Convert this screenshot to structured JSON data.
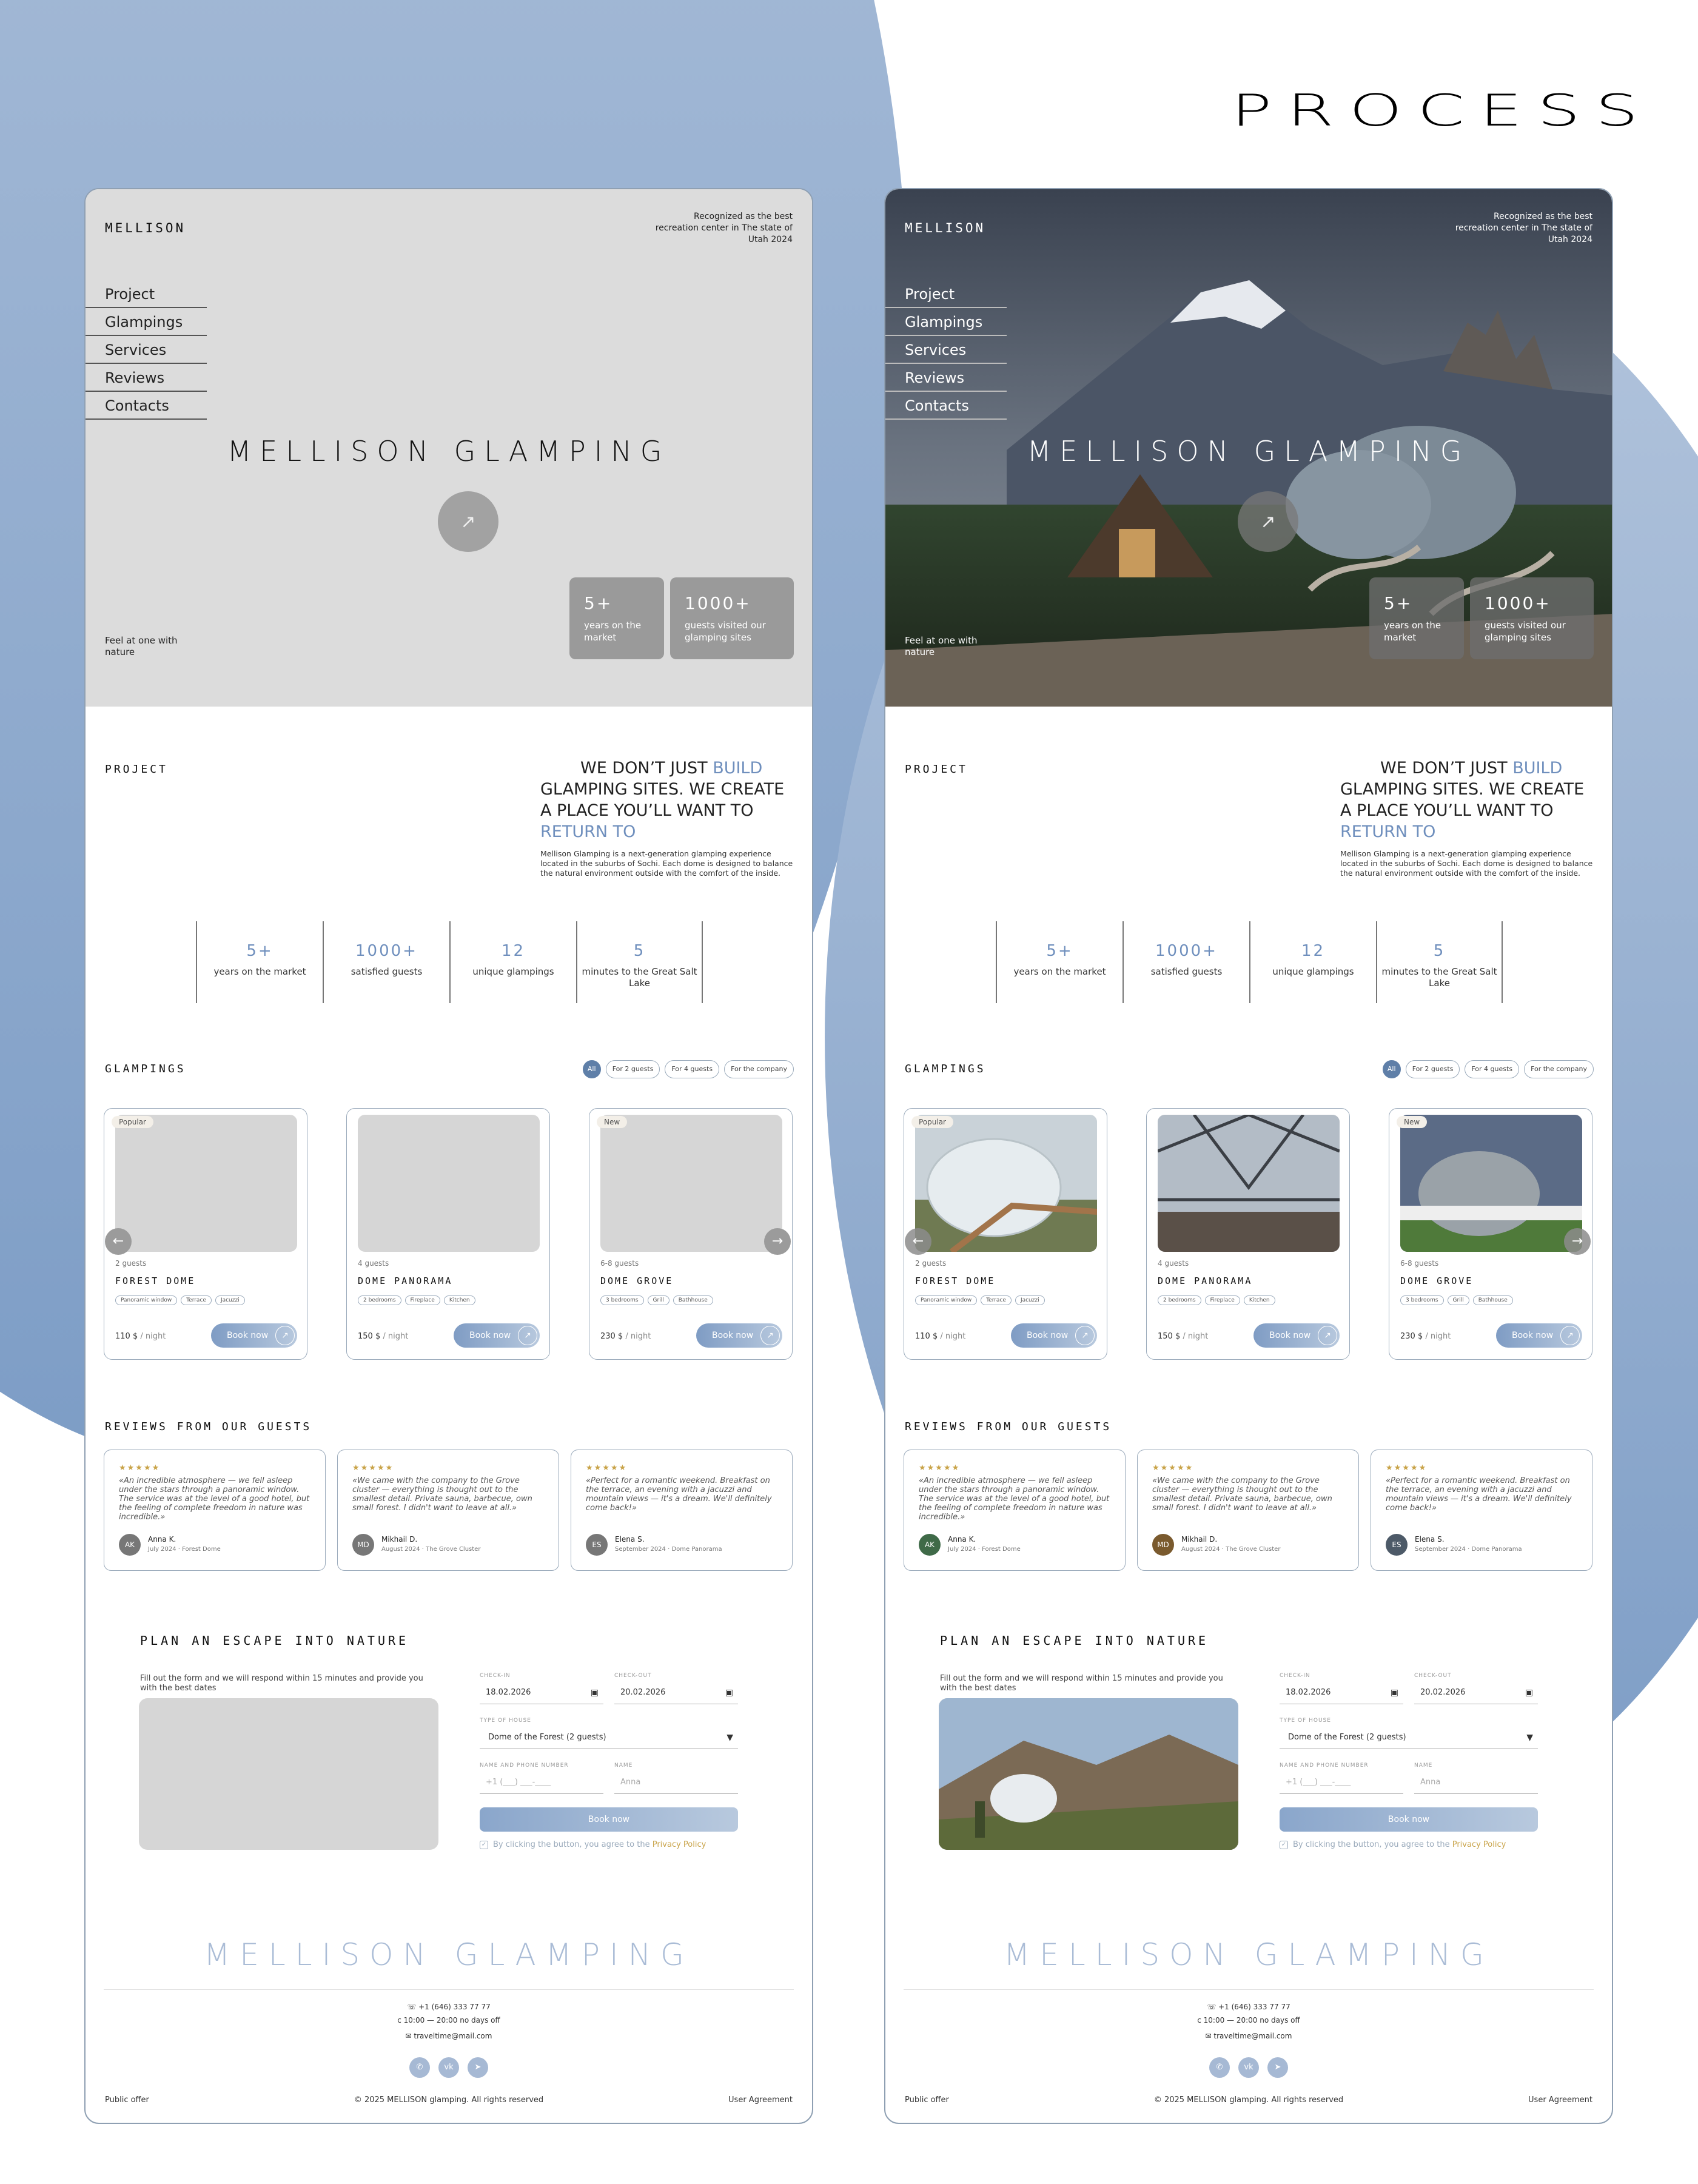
{
  "page": {
    "title": "PROCESS",
    "colors": {
      "accent": "#6f8fbd",
      "blob": "#8fa8cb",
      "gold": "#c9a44a"
    }
  },
  "site": {
    "logo": "MELLISON",
    "recognition": "Recognized as the best recreation center in The state of Utah 2024",
    "nav": [
      "Project",
      "Glampings",
      "Services",
      "Reviews",
      "Contacts"
    ],
    "hero_title": "MELLISON GLAMPING",
    "hero_button_icon": "arrow-up-right-icon",
    "hero_stats": [
      {
        "num": "5+",
        "label": "years on the market"
      },
      {
        "num": "1000+",
        "label": "guests visited our glamping sites"
      }
    ],
    "tagline": "Feel at one with nature",
    "project": {
      "label": "PROJECT",
      "heading": {
        "p1": "WE DON’T JUST ",
        "a1": "BUILD",
        "p2": "GLAMPING SITES. WE CREATE A PLACE YOU’LL WANT TO ",
        "a2": "RETURN TO"
      },
      "text": "Mellison Glamping is a next-generation glamping experience located in the suburbs of Sochi. Each dome is designed to balance the natural environment outside with the comfort of the inside.",
      "stats": [
        {
          "num": "5+",
          "label": "years on the market"
        },
        {
          "num": "1000+",
          "label": "satisfied guests"
        },
        {
          "num": "12",
          "label": "unique glampings"
        },
        {
          "num": "5",
          "label": "minutes to the Great Salt Lake"
        }
      ]
    },
    "glampings": {
      "label": "GLAMPINGS",
      "filters": [
        "All",
        "For 2 guests",
        "For 4 guests",
        "For the company"
      ],
      "cards": [
        {
          "tag": "Popular",
          "guests": "2 guests",
          "name": "FOREST DOME",
          "amenities": [
            "Panoramic window",
            "Terrace",
            "Jacuzzi"
          ],
          "price": "110 $",
          "per": "/ night",
          "button": "Book now"
        },
        {
          "tag": "",
          "guests": "4 guests",
          "name": "DOME PANORAMA",
          "amenities": [
            "2 bedrooms",
            "Fireplace",
            "Kitchen"
          ],
          "price": "150 $",
          "per": "/ night",
          "button": "Book now"
        },
        {
          "tag": "New",
          "guests": "6-8 guests",
          "name": "DOME GROVE",
          "amenities": [
            "3 bedrooms",
            "Grill",
            "Bathhouse"
          ],
          "price": "230 $",
          "per": "/ night",
          "button": "Book now"
        }
      ]
    },
    "reviews": {
      "label": "REVIEWS FROM OUR GUESTS",
      "stars": "★★★★★",
      "items": [
        {
          "text": "«An incredible atmosphere — we fell asleep under the stars through a panoramic window. The service was at the level of a good hotel, but the feeling of complete freedom in nature was incredible.»",
          "initials": "AK",
          "name": "Anna K.",
          "date": "July 2024 · Forest Dome",
          "color": "#3f6a48"
        },
        {
          "text": "«We came with the company to the Grove cluster — everything is thought out to the smallest detail. Private sauna, barbecue, own small forest. I didn't want to leave at all.»",
          "initials": "MD",
          "name": "Mikhail D.",
          "date": "August 2024 · The Grove Cluster",
          "color": "#7a5a2e"
        },
        {
          "text": "«Perfect for a romantic weekend. Breakfast on the terrace, an evening with a jacuzzi and mountain views — it's a dream. We'll definitely come back!»",
          "initials": "ES",
          "name": "Elena S.",
          "date": "September 2024 · Dome Panorama",
          "color": "#4d5a68"
        }
      ]
    },
    "form": {
      "title": "PLAN AN ESCAPE INTO NATURE",
      "subtitle": "Fill out the form and we will respond within 15 minutes and provide you with the best dates",
      "checkin_label": "CHECK-IN",
      "checkin_value": "18.02.2026",
      "checkout_label": "CHECK-OUT",
      "checkout_value": "20.02.2026",
      "type_label": "TYPE OF HOUSE",
      "type_value": "Dome of the Forest (2 guests)",
      "phone_label": "NAME AND PHONE NUMBER",
      "phone_placeholder": "+1 (___) ___-____",
      "name_label": "NAME",
      "name_placeholder": "Anna",
      "submit": "Book now",
      "agree_text": "By clicking the button, you agree to the ",
      "agree_link": "Privacy Policy"
    },
    "footer": {
      "logo": "MELLISON GLAMPING",
      "phone": "+1 (646) 333 77 77",
      "hours": "c 10:00 — 20:00 no days off",
      "email": "traveltime@mail.com",
      "socials": [
        "whatsapp-icon",
        "vk-icon",
        "telegram-icon"
      ],
      "public_offer": "Public offer",
      "copyright": "© 2025 MELLISON glamping. All rights reserved",
      "user_agreement": "User Agreement"
    }
  }
}
